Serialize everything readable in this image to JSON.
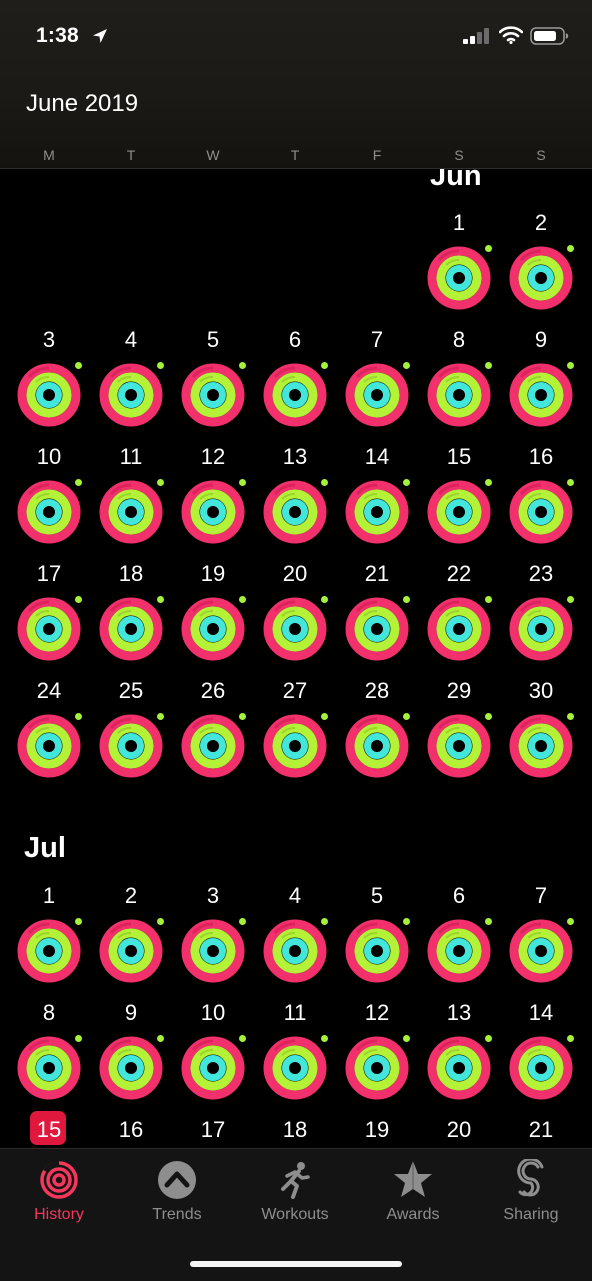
{
  "status_bar": {
    "time": "1:38"
  },
  "header": {
    "title": "June 2019",
    "weekdays": [
      "M",
      "T",
      "W",
      "T",
      "F",
      "S",
      "S"
    ]
  },
  "calendar": {
    "june": {
      "label": "Jun",
      "days": [
        "1",
        "2",
        "3",
        "4",
        "5",
        "6",
        "7",
        "8",
        "9",
        "10",
        "11",
        "12",
        "13",
        "14",
        "15",
        "16",
        "17",
        "18",
        "19",
        "20",
        "21",
        "22",
        "23",
        "24",
        "25",
        "26",
        "27",
        "28",
        "29",
        "30"
      ]
    },
    "july": {
      "label": "Jul",
      "days": [
        "1",
        "2",
        "3",
        "4",
        "5",
        "6",
        "7",
        "8",
        "9",
        "10",
        "11",
        "12",
        "13",
        "14",
        "15",
        "16",
        "17",
        "18",
        "19",
        "20",
        "21"
      ],
      "today": "15"
    }
  },
  "colors": {
    "move": "#f2306b",
    "exercise": "#b4f238",
    "stand": "#43e6db",
    "today_badge": "#e0183d",
    "active_tab": "#f5375e"
  },
  "tabs": [
    {
      "label": "History",
      "icon": "history-rings-icon",
      "active": true
    },
    {
      "label": "Trends",
      "icon": "trends-chevron-icon",
      "active": false
    },
    {
      "label": "Workouts",
      "icon": "running-figure-icon",
      "active": false
    },
    {
      "label": "Awards",
      "icon": "award-star-icon",
      "active": false
    },
    {
      "label": "Sharing",
      "icon": "sharing-s-icon",
      "active": false
    }
  ]
}
